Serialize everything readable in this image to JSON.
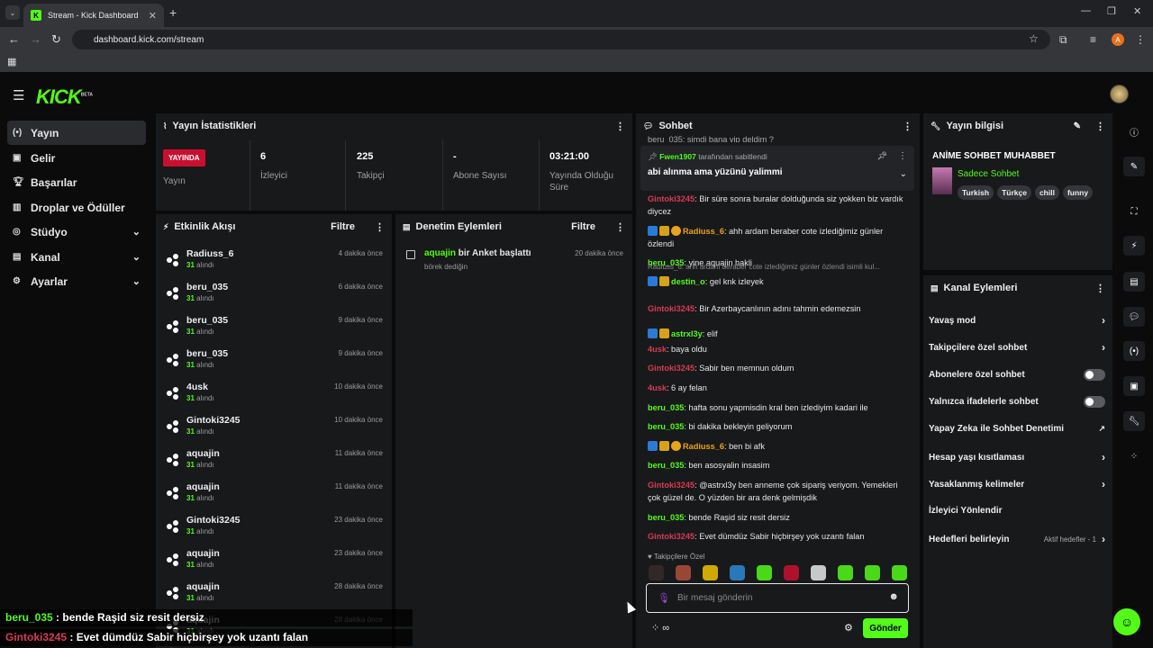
{
  "browser": {
    "tab_title": "Stream - Kick Dashboard",
    "url": "dashboard.kick.com/stream",
    "profile_initial": "A"
  },
  "brand": {
    "logo": "KICK",
    "beta": "BETA",
    "accent": "#53fc18"
  },
  "sidebar": {
    "items": [
      {
        "label": "Yayın",
        "icon": "broadcast-icon"
      },
      {
        "label": "Gelir",
        "icon": "revenue-icon"
      },
      {
        "label": "Başarılar",
        "icon": "trophy-icon"
      },
      {
        "label": "Droplar ve Ödüller",
        "icon": "gift-icon"
      },
      {
        "label": "Stüdyo",
        "icon": "studio-icon"
      },
      {
        "label": "Kanal",
        "icon": "channel-icon"
      },
      {
        "label": "Ayarlar",
        "icon": "gear-icon"
      }
    ]
  },
  "stats": {
    "title": "Yayın İstatistikleri",
    "live_badge": "YAYINDA",
    "live_label": "Yayın",
    "viewers": "6",
    "viewers_label": "İzleyici",
    "followers": "225",
    "followers_label": "Takipçi",
    "subs": "-",
    "subs_label": "Abone Sayısı",
    "uptime": "03:21:00",
    "uptime_label": "Yayında Olduğu Süre"
  },
  "activity": {
    "title": "Etkinlik Akışı",
    "filter": "Filtre",
    "items": [
      {
        "name": "Radiuss_6",
        "amount": "31",
        "suffix": "alındı",
        "time": "4 dakika önce"
      },
      {
        "name": "beru_035",
        "amount": "31",
        "suffix": "alındı",
        "time": "6 dakika önce"
      },
      {
        "name": "beru_035",
        "amount": "31",
        "suffix": "alındı",
        "time": "9 dakika önce"
      },
      {
        "name": "beru_035",
        "amount": "31",
        "suffix": "alındı",
        "time": "9 dakika önce"
      },
      {
        "name": "4usk",
        "amount": "31",
        "suffix": "alındı",
        "time": "10 dakika önce"
      },
      {
        "name": "Gintoki3245",
        "amount": "31",
        "suffix": "alındı",
        "time": "10 dakika önce"
      },
      {
        "name": "aquajin",
        "amount": "31",
        "suffix": "alındı",
        "time": "11 dakika önce"
      },
      {
        "name": "aquajin",
        "amount": "31",
        "suffix": "alındı",
        "time": "11 dakika önce"
      },
      {
        "name": "Gintoki3245",
        "amount": "31",
        "suffix": "alındı",
        "time": "23 dakika önce"
      },
      {
        "name": "aquajin",
        "amount": "31",
        "suffix": "alındı",
        "time": "23 dakika önce"
      },
      {
        "name": "aquajin",
        "amount": "31",
        "suffix": "alındı",
        "time": "28 dakika önce"
      },
      {
        "name": "aquajin",
        "amount": "31",
        "suffix": "alındı",
        "time": "28 dakika önce"
      }
    ]
  },
  "moderation": {
    "title": "Denetim Eylemleri",
    "filter": "Filtre",
    "items": [
      {
        "user": "aquajin",
        "action": "bir Anket başlattı",
        "detail": "börek dediğin",
        "time": "20 dakika önce"
      }
    ]
  },
  "chat": {
    "title": "Sohbet",
    "top_partial": "beru_035: şimdi bana vip deldim ?",
    "pinned_by": "Fwen1907",
    "pinned_suffix": "tarafından sabitlendi",
    "pinned_text": "abi alınma ama yüzünü yalimmi",
    "messages": [
      {
        "user": "Gintoki3245",
        "color": "#d63b54",
        "text": ": Bir süre sonra buralar dolduğunda siz yokken biz vardık diycez",
        "badges": []
      },
      {
        "user": "Radiuss_6",
        "color": "#e8a31c",
        "text": ": ahh ardam beraber cote izlediğimiz günler özlendi",
        "badges": [
          "b1",
          "b2",
          "b3"
        ]
      },
      {
        "user": "beru_035",
        "color": "#53fc18",
        "text": ": yine aquajin hakli",
        "badges": []
      },
      {
        "user": "destin_o",
        "color": "#53fc18",
        "text": ": gel knk izleyek",
        "badges": [
          "b1",
          "b2"
        ],
        "reply": "Radiuss_6: ahh ardam beraber cote izlediğimiz günler özlendi isimli kul..."
      },
      {
        "user": "Gintoki3245",
        "color": "#d63b54",
        "text": ": Bir Azerbaycanlının adını tahmin edemezsin",
        "badges": []
      },
      {
        "user": "astrxl3y",
        "color": "#53fc18",
        "text": ": elif",
        "badges": [
          "b1",
          "b2"
        ]
      },
      {
        "user": "4usk",
        "color": "#d63b54",
        "text": ": baya oldu",
        "badges": []
      },
      {
        "user": "Gintoki3245",
        "color": "#d63b54",
        "text": ": Sabir ben memnun oldum",
        "badges": []
      },
      {
        "user": "4usk",
        "color": "#d63b54",
        "text": ": 6 ay felan",
        "badges": []
      },
      {
        "user": "beru_035",
        "color": "#53fc18",
        "text": ": hafta sonu yapmisdin kral ben izlediyim kadari ile",
        "badges": []
      },
      {
        "user": "beru_035",
        "color": "#53fc18",
        "text": ": bi dakika bekleyin geliyorum",
        "badges": []
      },
      {
        "user": "Radiuss_6",
        "color": "#e8a31c",
        "text": ": ben bi afk",
        "badges": [
          "b1",
          "b2",
          "b3"
        ]
      },
      {
        "user": "beru_035",
        "color": "#53fc18",
        "text": ": ben asosyalin insasim",
        "badges": []
      },
      {
        "user": "Gintoki3245",
        "color": "#d63b54",
        "text": ": @astrxl3y ben anneme çok sipariş veriyom. Yemekleri çok güzel de. O yüzden bir ara denk gelmişdik",
        "badges": []
      },
      {
        "user": "beru_035",
        "color": "#53fc18",
        "text": ": bende Raşid siz resit dersiz",
        "badges": []
      },
      {
        "user": "Gintoki3245",
        "color": "#d63b54",
        "text": ": Evet dümdüz Sabir hiçbirşey yok uzantı falan",
        "badges": []
      }
    ],
    "followers_only": "Takipçilere Özel",
    "placeholder": "Bir mesaj gönderin",
    "send": "Gönder"
  },
  "stream_info": {
    "title": "Yayın bilgisi",
    "stream_title": "ANİME SOHBET MUHABBET",
    "category": "Sadece Sohbet",
    "tags": [
      "Turkish",
      "Türkçe",
      "chill",
      "funny"
    ]
  },
  "channel_actions": {
    "title": "Kanal Eylemleri",
    "items": [
      {
        "label": "Yavaş mod",
        "kind": "arrow"
      },
      {
        "label": "Takipçilere özel sohbet",
        "kind": "arrow"
      },
      {
        "label": "Abonelere özel sohbet",
        "kind": "toggle"
      },
      {
        "label": "Yalnızca ifadelerle sohbet",
        "kind": "toggle"
      },
      {
        "label": "Yapay Zeka ile Sohbet Denetimi",
        "kind": "ext"
      },
      {
        "label": "Hesap yaşı kısıtlaması",
        "kind": "arrow"
      },
      {
        "label": "Yasaklanmış kelimeler",
        "kind": "arrow"
      },
      {
        "label": "İzleyici Yönlendir",
        "kind": "none"
      },
      {
        "label": "Hedefleri belirleyin",
        "kind": "goal",
        "extra": "Aktif hedefler - 1"
      }
    ]
  },
  "overlay": [
    {
      "user": "beru_035",
      "user_color": "#53fc18",
      "text": " : bende Raşid siz resit dersiz"
    },
    {
      "user": "Gintoki3245",
      "user_color": "#d63b54",
      "text": " : Evet dümdüz Sabir hiçbirşey yok uzantı falan"
    }
  ]
}
